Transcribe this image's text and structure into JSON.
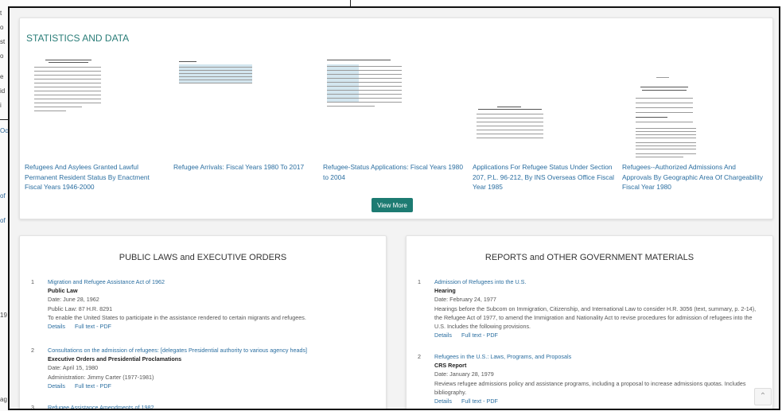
{
  "statistics": {
    "heading": "STATISTICS AND DATA",
    "items": [
      {
        "title": "Refugees And Asylees Granted Lawful Permanent Resident Status By Enactment Fiscal Years 1946-2000"
      },
      {
        "title": "Refugee Arrivals: Fiscal Years 1980 To 2017"
      },
      {
        "title": "Refugee-Status Applications: Fiscal Years 1980 to 2004"
      },
      {
        "title": "Applications For Refugee Status Under Section 207, P.L. 96-212, By INS Overseas Office Fiscal Year 1985"
      },
      {
        "title": "Refugees--Authorized Admissions And Approvals By Geographic Area Of Chargeability Fiscal Year 1980"
      }
    ],
    "view_more_label": "View More"
  },
  "laws": {
    "heading": "PUBLIC LAWS and EXECUTIVE ORDERS",
    "entries": [
      {
        "number": "1",
        "title": "Migration and Refugee Assistance Act of 1962",
        "kind": "Public Law",
        "date": "Date: June 28, 1962",
        "meta": "Public Law: 87 H.R. 8291",
        "desc": "To enable the United States to participate in the assistance rendered to certain migrants and refugees.",
        "details": "Details",
        "fulltext": "Full text - PDF"
      },
      {
        "number": "2",
        "title": "Consultations on the admission of refugees: [delegates Presidential authority to various agency heads]",
        "kind": "Executive Orders and Presidential Proclamations",
        "date": "Date: April 15, 1980",
        "meta": "Administration: Jimmy Carter (1977-1981)",
        "details": "Details",
        "fulltext": "Full text - PDF"
      },
      {
        "number": "3",
        "title": "Refugee Assistance Amendments of 1982"
      }
    ]
  },
  "reports": {
    "heading": "REPORTS and OTHER GOVERNMENT MATERIALS",
    "entries": [
      {
        "number": "1",
        "title": "Admission of Refugees into the U.S.",
        "kind": "Hearing",
        "date": "Date: February 24, 1977",
        "desc": "Hearings before the Subcom on Immigration, Citizenship, and International Law to consider H.R. 3056 (text, summary, p. 2-14), the Refugee Act of 1977, to amend the Immigration and Nationality Act to revise procedures for admission of refugees into the U.S. Includes the following provisions.",
        "details": "Details",
        "fulltext": "Full text - PDF"
      },
      {
        "number": "2",
        "title": "Refugees in the U.S.: Laws, Programs, and Proposals",
        "kind": "CRS Report",
        "date": "Date: January 28, 1979",
        "desc": "Reviews refugee admissions policy and assistance programs, including a proposal to increase admissions quotas. Includes bibliography.",
        "details": "Details",
        "fulltext": "Full text - PDF"
      }
    ]
  },
  "background_fragments": [
    "t",
    "o",
    "st",
    "o",
    "e",
    "id",
    "i",
    "Oc",
    "of",
    "of",
    "19",
    "ag"
  ]
}
